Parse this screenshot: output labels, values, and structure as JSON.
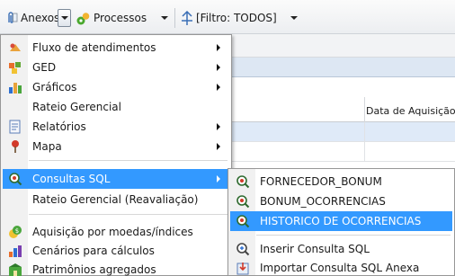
{
  "toolbar": {
    "anexos_label": "Anexos",
    "processos_label": "Processos",
    "filtro_label": "[Filtro: TODOS]"
  },
  "grid": {
    "column_header": "Data de Aquisição"
  },
  "menu": {
    "items": [
      {
        "label": "Fluxo de atendimentos",
        "icon": "flow-icon",
        "submenu": true
      },
      {
        "label": "GED",
        "icon": "ged-icon",
        "submenu": true
      },
      {
        "label": "Gráficos",
        "icon": "chart-icon",
        "submenu": true
      },
      {
        "label": "Rateio Gerencial",
        "icon": "",
        "submenu": false
      },
      {
        "label": "Relatórios",
        "icon": "report-icon",
        "submenu": true
      },
      {
        "label": "Mapa",
        "icon": "map-pin-icon",
        "submenu": true
      },
      {
        "label": "Consultas SQL",
        "icon": "sql-query-icon",
        "submenu": true
      },
      {
        "label": "Rateio Gerencial (Reavaliação)",
        "icon": "",
        "submenu": false
      },
      {
        "label": "Aquisição por moedas/índices",
        "icon": "currency-icon",
        "submenu": false
      },
      {
        "label": "Cenários para cálculos",
        "icon": "scenario-icon",
        "submenu": false
      },
      {
        "label": "Patrimônios agregados",
        "icon": "assets-icon",
        "submenu": false
      }
    ]
  },
  "submenu": {
    "items": [
      {
        "label": "FORNECEDOR_BONUM",
        "icon": "sql-query-icon"
      },
      {
        "label": "BONUM_OCORRENCIAS",
        "icon": "sql-query-icon"
      },
      {
        "label": "HISTORICO DE OCORRENCIAS",
        "icon": "sql-query-icon"
      },
      {
        "label": "Inserir Consulta SQL",
        "icon": "sql-insert-icon"
      },
      {
        "label": "Importar Consulta SQL Anexa",
        "icon": "import-icon"
      }
    ]
  },
  "colors": {
    "highlight": "#3399ff",
    "menu_border": "#979797"
  }
}
